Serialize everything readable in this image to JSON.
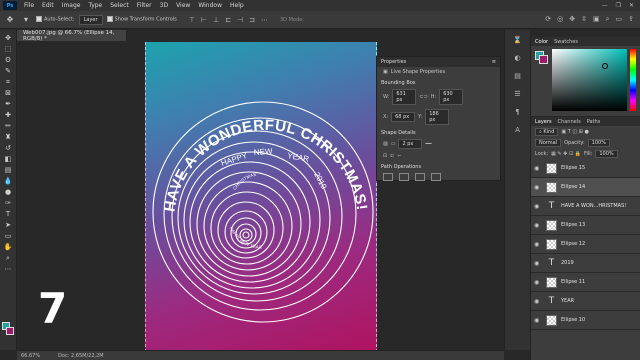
{
  "menubar": {
    "logo": "Ps",
    "items": [
      "File",
      "Edit",
      "Image",
      "Type",
      "Select",
      "Filter",
      "3D",
      "View",
      "Window",
      "Help"
    ],
    "window_controls": [
      "—",
      "❐",
      "✕"
    ]
  },
  "options": {
    "auto_select_label": "Auto-Select:",
    "auto_select_value": "Layer",
    "transform_label": "Show Transform Controls",
    "mode3d_label": "3D Mode:"
  },
  "document": {
    "tab_title": "Web007.jpg @ 66.7% (Ellipse 14, RGB/8) *",
    "zoom": "66.67%",
    "doc_size": "Doc: 2,65M/22,2M"
  },
  "artwork": {
    "headline": "HAVE A WONDERFUL CHRISTMAS!",
    "words": [
      "HAPPY",
      "NEW",
      "YEAR",
      "2019"
    ],
    "inner_text": "CHRISTMAS",
    "inner_text2": "HAPPY NEW YEAR",
    "ring_color": "#ffffff"
  },
  "properties": {
    "title": "Properties",
    "subtitle": "Live Shape Properties",
    "bbox_label": "Bounding Box",
    "w_label": "W:",
    "w_value": "631 px",
    "h_label": "H:",
    "h_value": "630 px",
    "x_label": "X:",
    "x_value": "68 px",
    "y_label": "Y:",
    "y_value": "186 px",
    "shape_details": "Shape Details",
    "stroke_size": "2 px",
    "path_ops": "Path Operations"
  },
  "color_panel": {
    "tabs": [
      "Color",
      "Swatches"
    ],
    "fg": "#22a3a0",
    "bg": "#9f1a6a"
  },
  "layers_panel": {
    "tabs": [
      "Layers",
      "Channels",
      "Paths"
    ],
    "kind_label": "Kind",
    "blend_mode": "Normal",
    "opacity_label": "Opacity:",
    "opacity": "100%",
    "lock_label": "Lock:",
    "fill_label": "Fill:",
    "fill": "100%",
    "items": [
      {
        "name": "Ellipse 15",
        "type": "shape",
        "active": false
      },
      {
        "name": "Ellipse 14",
        "type": "shape",
        "active": true
      },
      {
        "name": "HAVE A WON...HRISTMAS!",
        "type": "text",
        "active": false
      },
      {
        "name": "Ellipse 13",
        "type": "shape",
        "active": false
      },
      {
        "name": "Ellipse 12",
        "type": "shape",
        "active": false
      },
      {
        "name": "2019",
        "type": "text",
        "active": false
      },
      {
        "name": "Ellipse 11",
        "type": "shape",
        "active": false
      },
      {
        "name": "YEAR",
        "type": "text",
        "active": false
      },
      {
        "name": "Ellipse 10",
        "type": "shape",
        "active": false
      }
    ]
  },
  "brand_mark": "7"
}
